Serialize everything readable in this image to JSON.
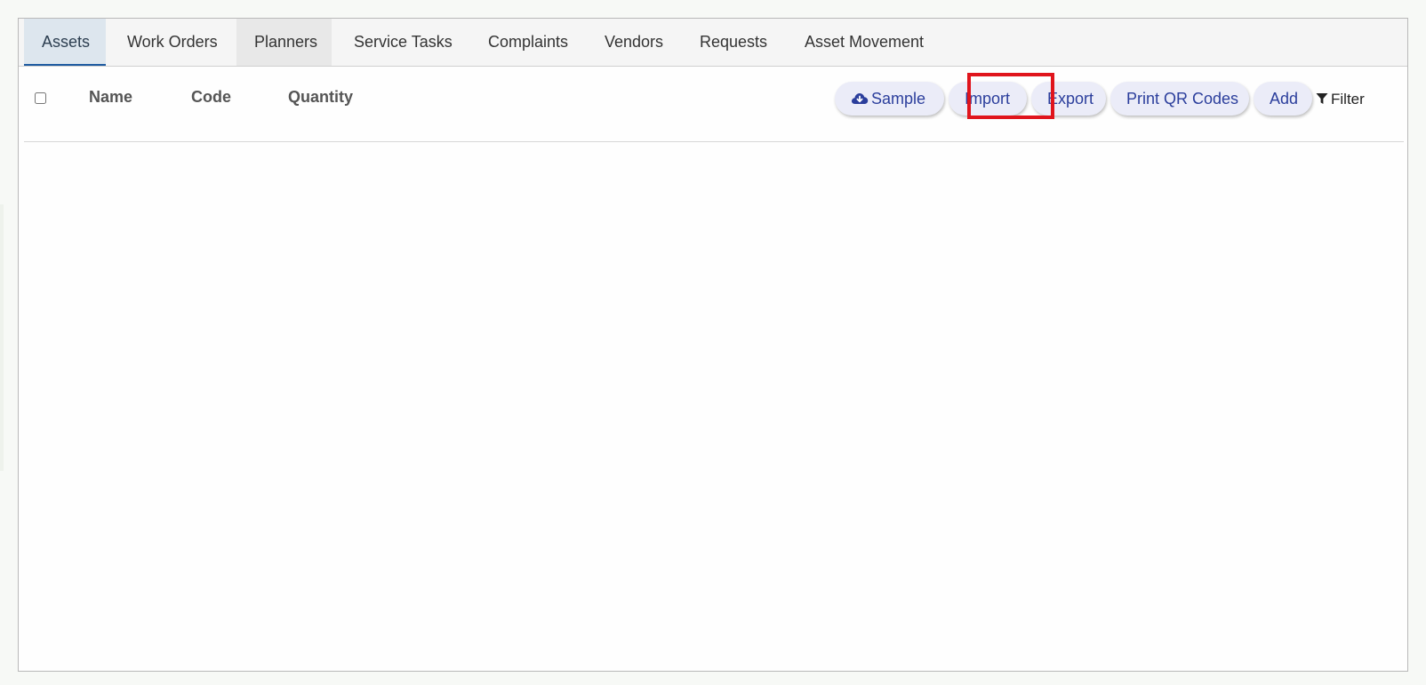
{
  "tabs": [
    {
      "label": "Assets",
      "active": true
    },
    {
      "label": "Work Orders",
      "active": false
    },
    {
      "label": "Planners",
      "active": false
    },
    {
      "label": "Service Tasks",
      "active": false
    },
    {
      "label": "Complaints",
      "active": false
    },
    {
      "label": "Vendors",
      "active": false
    },
    {
      "label": "Requests",
      "active": false
    },
    {
      "label": "Asset Movement",
      "active": false
    }
  ],
  "table": {
    "columns": [
      "Name",
      "Code",
      "Quantity"
    ],
    "rows": []
  },
  "toolbar": {
    "sample_label": "Sample",
    "sample_icon": "cloud-download-icon",
    "import_label": "Import",
    "export_label": "Export",
    "print_qr_label": "Print QR Codes",
    "add_label": "Add",
    "filter_label": "Filter",
    "filter_icon": "funnel-icon"
  },
  "colors": {
    "accent": "#2b3e9c",
    "active_tab_underline": "#1d5aa0",
    "highlight_box": "#e0141c"
  }
}
